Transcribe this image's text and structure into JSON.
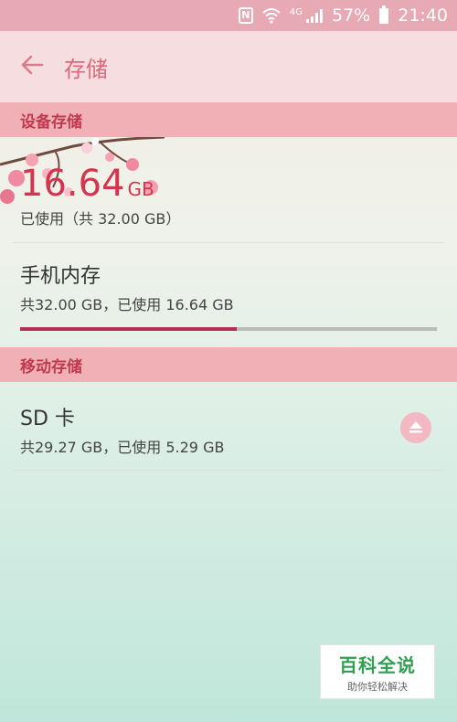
{
  "status_bar": {
    "icons": [
      "nfc-icon",
      "wifi-icon",
      "signal-icon",
      "battery-icon"
    ],
    "network_label": "4G",
    "battery_percent": "57%",
    "time": "21:40"
  },
  "app_bar": {
    "back_icon": "arrow-left-icon",
    "title": "存储"
  },
  "device_storage": {
    "header": "设备存储",
    "used_value": "16.64",
    "used_unit": "GB",
    "used_caption": "已使用（共 32.00 GB）",
    "internal": {
      "title": "手机内存",
      "subtitle": "共32.00 GB，已使用 16.64 GB",
      "used_fraction": 0.52
    }
  },
  "portable_storage": {
    "header": "移动存储",
    "sd_card": {
      "title": "SD 卡",
      "subtitle": "共29.27 GB，已使用 5.29 GB",
      "eject_icon": "eject-icon"
    }
  },
  "watermark": {
    "main": "百科全说",
    "sub": "助你轻松解决"
  },
  "colors": {
    "status_bar": "#e7a9b4",
    "app_bar": "#f6dde0",
    "section_header": "#f0b1b6",
    "accent": "#d4354e",
    "progress": "#b32d54"
  }
}
